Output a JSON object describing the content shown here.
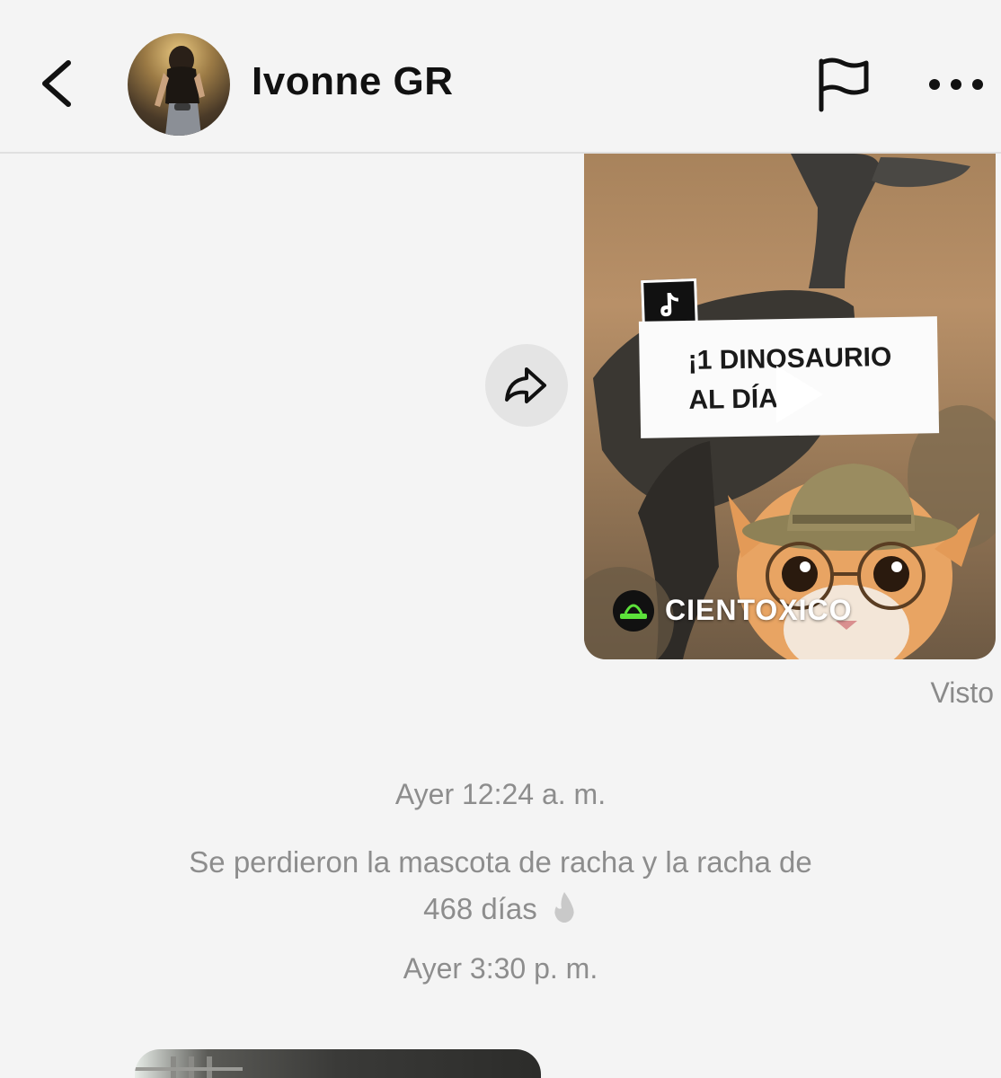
{
  "header": {
    "contact_name": "Ivonne GR",
    "back_icon": "chevron-left-icon",
    "report_icon": "flag-icon",
    "more_icon": "ellipsis-icon"
  },
  "messages": {
    "shared_video": {
      "title_line1": "¡1 DINOSAURIO",
      "title_line2": "AL DÍA",
      "source_brand": "CIENTOXICO",
      "logo_text": "Cientoxico",
      "platform_icon": "tiktok-icon"
    },
    "status": "Visto",
    "system": {
      "timestamp_1": "Ayer 12:24 a. m.",
      "streak_line1": "Se perdieron la mascota de racha y la racha de",
      "streak_line2": "468 días",
      "timestamp_2": "Ayer 3:30 p. m."
    }
  },
  "colors": {
    "background": "#f4f4f4",
    "text_primary": "#111111",
    "text_secondary": "#8d8d8d",
    "share_bubble": "#e4e4e4"
  }
}
